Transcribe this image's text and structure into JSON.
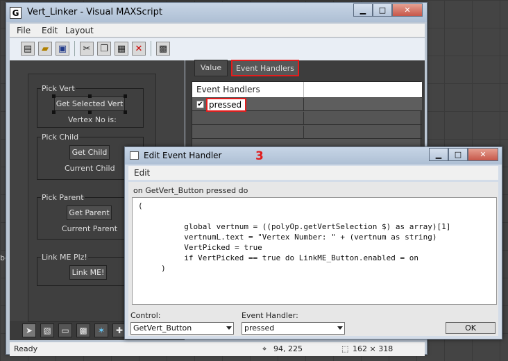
{
  "background": {
    "left_fragment": "be"
  },
  "window": {
    "title": "Vert_Linker - Visual MAXScript",
    "icon_letter": "G",
    "minimize": "▁",
    "maximize": "□",
    "close": "✕"
  },
  "menu": [
    "File",
    "Edit",
    "Layout"
  ],
  "toolbar_icons": [
    "new-icon",
    "open-icon",
    "save-icon",
    "cut-icon",
    "copy-icon",
    "paste-icon",
    "delete-icon",
    "grid-icon"
  ],
  "form": {
    "groups": {
      "pick_vert": {
        "label": "Pick Vert",
        "button": "Get Selected Vert",
        "text": "Vertex No is:"
      },
      "pick_child": {
        "label": "Pick Child",
        "button": "Get Child",
        "text": "Current Child"
      },
      "pick_parent": {
        "label": "Pick Parent",
        "button": "Get Parent",
        "text": "Current Parent"
      },
      "link_me": {
        "label": "Link ME Plz!",
        "button": "Link ME!"
      }
    }
  },
  "tabs": {
    "value": "Value",
    "event_handlers": "Event Handlers",
    "active": "event_handlers"
  },
  "handler_grid": {
    "header": "Event Handlers",
    "rows": [
      {
        "label": "pressed",
        "checked": true
      }
    ]
  },
  "status": {
    "left": "Ready",
    "coords": "94, 225",
    "size": "162 × 318"
  },
  "dialog": {
    "title": "Edit Event Handler",
    "badge": "3",
    "menu": "Edit",
    "header": "on GetVert_Button pressed do",
    "code": "(\n\n          global vertnum = ((polyOp.getVertSelection $) as array)[1]\n          vertnumL.text = \"Vertex Number: \" + (vertnum as string)\n          VertPicked = true\n          if VertPicked == true do LinkME_Button.enabled = on\n     )",
    "control_label": "Control:",
    "control_value": "GetVert_Button",
    "handler_label": "Event Handler:",
    "handler_value": "pressed",
    "ok": "OK",
    "minimize": "▁",
    "maximize": "□",
    "close": "✕"
  },
  "colors": {
    "highlight": "#e41c1c",
    "dark_panel": "#3f3f3f"
  }
}
